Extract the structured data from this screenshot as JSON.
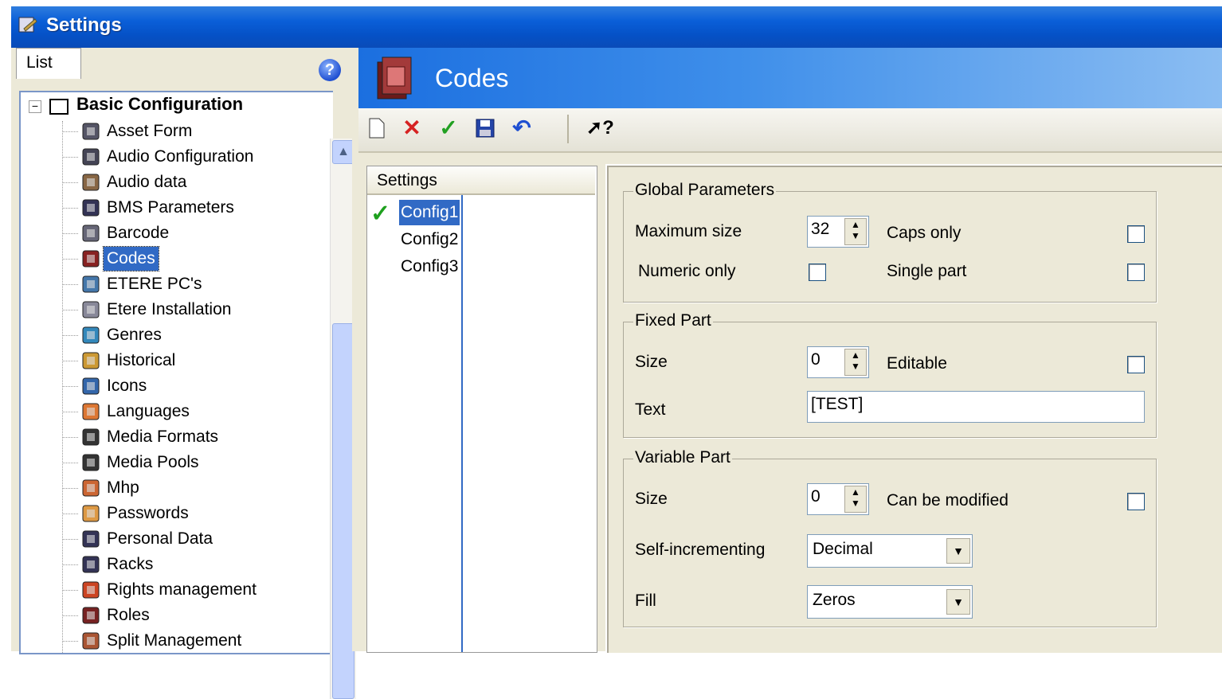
{
  "window": {
    "title": "Settings"
  },
  "left": {
    "tab_label": "List",
    "help_glyph": "?",
    "tree": {
      "root_label": "Basic Configuration",
      "items": [
        {
          "label": "Asset Form",
          "icon": "asset-form-icon"
        },
        {
          "label": "Audio Configuration",
          "icon": "audio-configuration-icon"
        },
        {
          "label": "Audio data",
          "icon": "audio-data-icon"
        },
        {
          "label": "BMS Parameters",
          "icon": "bms-parameters-icon"
        },
        {
          "label": "Barcode",
          "icon": "barcode-icon"
        },
        {
          "label": "Codes",
          "icon": "codes-icon",
          "selected": true
        },
        {
          "label": "ETERE PC's",
          "icon": "etere-pcs-icon"
        },
        {
          "label": "Etere Installation",
          "icon": "etere-installation-icon"
        },
        {
          "label": "Genres",
          "icon": "genres-icon"
        },
        {
          "label": "Historical",
          "icon": "historical-icon"
        },
        {
          "label": "Icons",
          "icon": "icons-icon"
        },
        {
          "label": "Languages",
          "icon": "languages-icon"
        },
        {
          "label": "Media Formats",
          "icon": "media-formats-icon"
        },
        {
          "label": "Media Pools",
          "icon": "media-pools-icon"
        },
        {
          "label": "Mhp",
          "icon": "mhp-icon"
        },
        {
          "label": "Passwords",
          "icon": "passwords-icon"
        },
        {
          "label": "Personal Data",
          "icon": "personal-data-icon"
        },
        {
          "label": "Racks",
          "icon": "racks-icon"
        },
        {
          "label": "Rights management",
          "icon": "rights-management-icon"
        },
        {
          "label": "Roles",
          "icon": "roles-icon"
        },
        {
          "label": "Split Management",
          "icon": "split-management-icon"
        }
      ]
    }
  },
  "header": {
    "title": "Codes"
  },
  "toolbar": {
    "help_glyph": "?"
  },
  "configs": {
    "header": "Settings",
    "items": [
      "Config1",
      "Config2",
      "Config3"
    ],
    "selected": "Config1"
  },
  "global": {
    "title": "Global Parameters",
    "max_size_label": "Maximum size",
    "max_size_value": "32",
    "caps_only_label": "Caps only",
    "numeric_only_label": "Numeric only",
    "single_part_label": "Single part"
  },
  "fixed": {
    "title": "Fixed Part",
    "size_label": "Size",
    "size_value": "0",
    "editable_label": "Editable",
    "text_label": "Text",
    "text_value": "[TEST]"
  },
  "variable": {
    "title": "Variable Part",
    "size_label": "Size",
    "size_value": "0",
    "can_modify_label": "Can be modified",
    "self_inc_label": "Self-incrementing",
    "self_inc_value": "Decimal",
    "fill_label": "Fill",
    "fill_value": "Zeros"
  },
  "colors": {
    "titlebar": "#0a5fd8",
    "selection": "#316ac5",
    "panel_bg": "#ece9d8"
  }
}
